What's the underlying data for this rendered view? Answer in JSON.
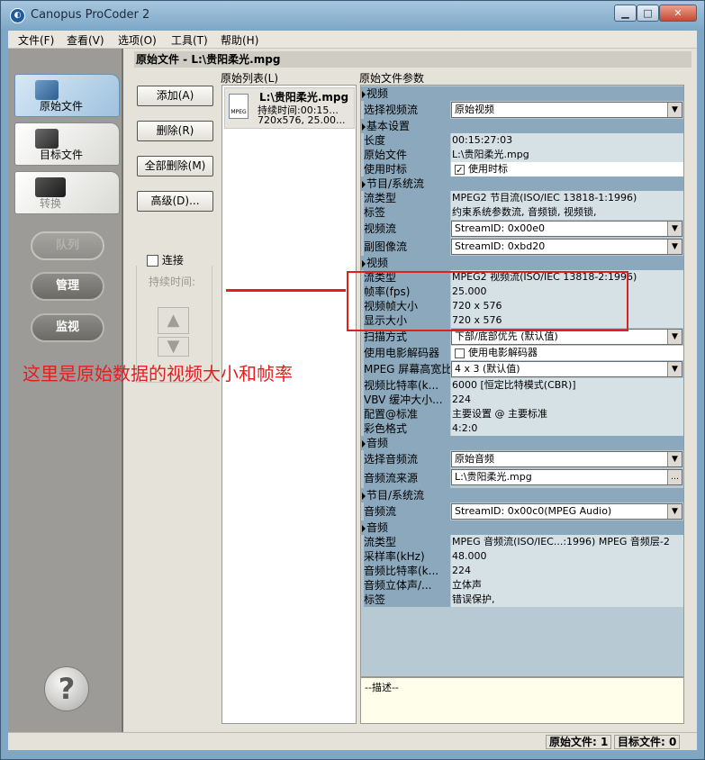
{
  "window": {
    "title": "Canopus ProCoder 2"
  },
  "menu": [
    "文件(F)",
    "查看(V)",
    "选项(O)",
    "工具(T)",
    "帮助(H)"
  ],
  "nav": {
    "source": "原始文件",
    "target": "目标文件",
    "convert": "转换",
    "queue": "队列",
    "manage": "管理",
    "monitor": "监视",
    "help": "?"
  },
  "path_header": "原始文件 - L:\\贵阳柔光.mpg",
  "buttons": {
    "add": "添加(A)",
    "delete": "删除(R)",
    "delete_all": "全部删除(M)",
    "advanced": "高级(D)..."
  },
  "join": {
    "label": "连接",
    "duration": "持续时间:"
  },
  "file_list": {
    "header": "原始列表(L)",
    "item": {
      "icon_label": "MPEG",
      "name": "L:\\贵阳柔光.mpg",
      "duration": "持续时间:00:15...",
      "size": "720x576, 25.00..."
    }
  },
  "params": {
    "header": "原始文件参数",
    "rows": [
      {
        "type": "section",
        "label": "视频"
      },
      {
        "type": "select",
        "key": "选择视频流",
        "value": "原始视频"
      },
      {
        "type": "section",
        "label": "基本设置"
      },
      {
        "type": "value",
        "key": "长度",
        "value": "00:15:27:03"
      },
      {
        "type": "value",
        "key": "原始文件",
        "value": "L:\\贵阳柔光.mpg"
      },
      {
        "type": "check",
        "key": "使用时标",
        "value": "使用时标",
        "checked": true
      },
      {
        "type": "section",
        "label": "节目/系统流"
      },
      {
        "type": "value",
        "key": "流类型",
        "value": "MPEG2 节目流(ISO/IEC 13818-1:1996)"
      },
      {
        "type": "value",
        "key": "标签",
        "value": "约束系统参数流, 音频锁, 视频锁,"
      },
      {
        "type": "select",
        "key": "视频流",
        "value": "StreamID: 0x00e0"
      },
      {
        "type": "select",
        "key": "副图像流",
        "value": "StreamID: 0xbd20"
      },
      {
        "type": "section",
        "label": "视频"
      },
      {
        "type": "value",
        "key": "流类型",
        "value": "MPEG2 视频流(ISO/IEC 13818-2:1996)"
      },
      {
        "type": "value",
        "key": "帧率(fps)",
        "value": "25.000"
      },
      {
        "type": "value",
        "key": "视频帧大小",
        "value": "720 x 576"
      },
      {
        "type": "value",
        "key": "显示大小",
        "value": "720 x 576"
      },
      {
        "type": "select",
        "key": "扫描方式",
        "value": "下部/底部优先 (默认值)"
      },
      {
        "type": "check",
        "key": "使用电影解码器",
        "value": "使用电影解码器",
        "checked": false
      },
      {
        "type": "select",
        "key": "MPEG 屏幕高宽比",
        "value": "4 x 3 (默认值)"
      },
      {
        "type": "value",
        "key": "视频比特率(k...",
        "value": "6000 [恒定比特模式(CBR)]"
      },
      {
        "type": "value",
        "key": "VBV 缓冲大小...",
        "value": "224"
      },
      {
        "type": "value",
        "key": "配置@标准",
        "value": "主要设置 @ 主要标准"
      },
      {
        "type": "value",
        "key": "彩色格式",
        "value": "4:2:0"
      },
      {
        "type": "section",
        "label": "音频"
      },
      {
        "type": "select",
        "key": "选择音频流",
        "value": "原始音频"
      },
      {
        "type": "browse",
        "key": "音频流来源",
        "value": "L:\\贵阳柔光.mpg"
      },
      {
        "type": "section",
        "label": "节目/系统流"
      },
      {
        "type": "select",
        "key": "音频流",
        "value": "StreamID: 0x00c0(MPEG Audio)"
      },
      {
        "type": "section",
        "label": "音频"
      },
      {
        "type": "value",
        "key": "流类型",
        "value": "MPEG 音频流(ISO/IEC...:1996)  MPEG 音频层-2"
      },
      {
        "type": "value",
        "key": "采样率(kHz)",
        "value": "48.000"
      },
      {
        "type": "value",
        "key": "音频比特率(k...",
        "value": "224"
      },
      {
        "type": "value",
        "key": "音频立体声/...",
        "value": "立体声"
      },
      {
        "type": "value",
        "key": "标签",
        "value": "错误保护,"
      }
    ]
  },
  "description": "--描述--",
  "status": {
    "source": "原始文件: 1",
    "target": "目标文件: 0"
  },
  "annotation": "这里是原始数据的视频大小和帧率",
  "colors": {
    "annotation": "#e02020",
    "section": "#8ca8bd",
    "value_bg": "#d6e1e6"
  }
}
